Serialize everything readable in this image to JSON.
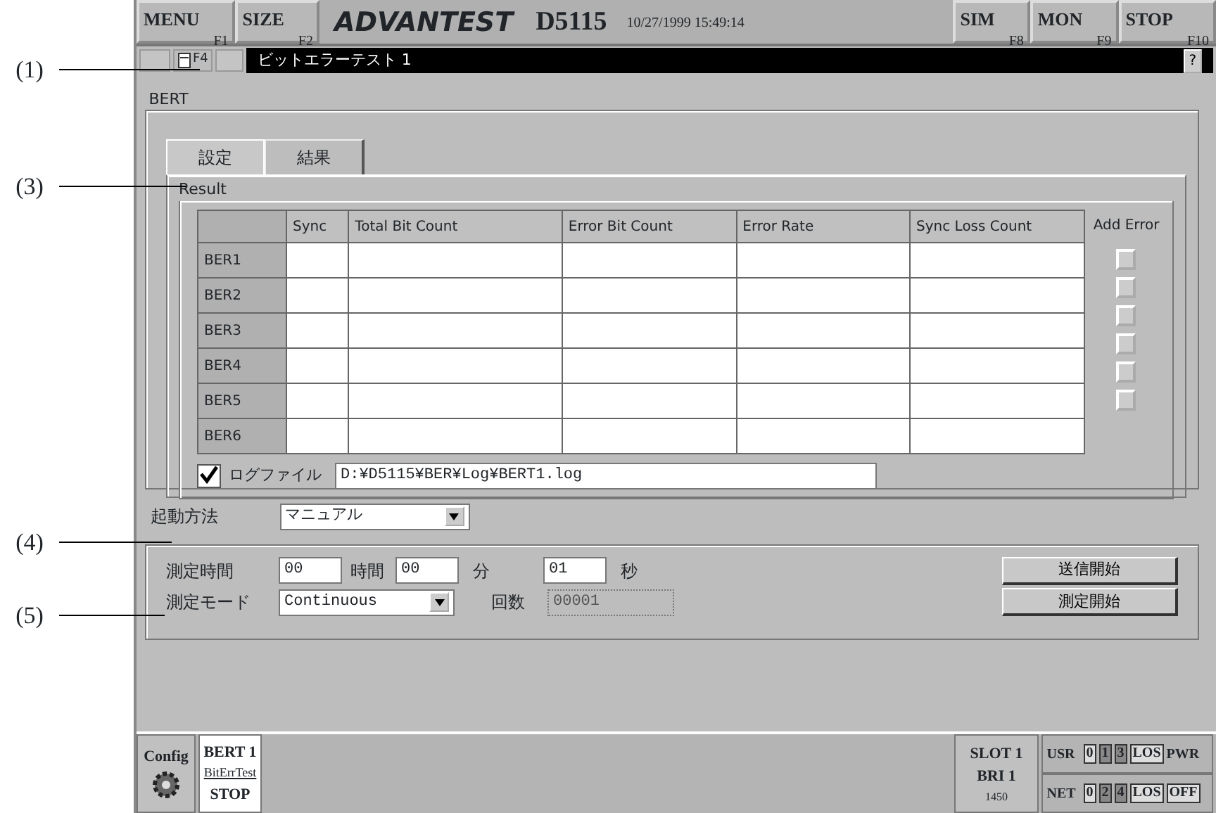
{
  "callouts": [
    {
      "label": "(1)"
    },
    {
      "label": "(3)"
    },
    {
      "label": "(4)"
    },
    {
      "label": "(5)"
    }
  ],
  "top_bar": {
    "left_keys": [
      {
        "label": "MENU",
        "fkey": "F1"
      },
      {
        "label": "SIZE",
        "fkey": "F2"
      }
    ],
    "brand": "ADVANTEST",
    "model": "D5115",
    "datetime": "10/27/1999 15:49:14",
    "right_keys": [
      {
        "label": "SIM",
        "fkey": "F8"
      },
      {
        "label": "MON",
        "fkey": "F9"
      },
      {
        "label": "STOP",
        "fkey": "F10"
      }
    ]
  },
  "toolbar": {
    "fkey": "F4"
  },
  "window": {
    "title": "ビットエラーテスト 1",
    "help": "?"
  },
  "group_label": "BERT",
  "tabs": [
    {
      "label": "設定",
      "selected": false
    },
    {
      "label": "結果",
      "selected": true
    }
  ],
  "result": {
    "label": "Result",
    "columns": [
      "Sync",
      "Total Bit Count",
      "Error Bit Count",
      "Error Rate",
      "Sync Loss Count"
    ],
    "add_error": "Add Error",
    "rows": [
      {
        "name": "BER1"
      },
      {
        "name": "BER2"
      },
      {
        "name": "BER3"
      },
      {
        "name": "BER4"
      },
      {
        "name": "BER5"
      },
      {
        "name": "BER6"
      }
    ]
  },
  "log": {
    "checked": true,
    "label": "ログファイル",
    "value": "D:¥D5115¥BER¥Log¥BERT1.log"
  },
  "start_method": {
    "label": "起動方法",
    "value": "マニュアル"
  },
  "measure": {
    "time_label": "測定時間",
    "hours": "00",
    "hours_unit": "時間",
    "minutes": "00",
    "minutes_unit": "分",
    "seconds": "01",
    "seconds_unit": "秒",
    "mode_label": "測定モード",
    "mode": "Continuous",
    "count_label": "回数",
    "count": "00001",
    "count_disabled": true,
    "buttons": [
      "送信開始",
      "測定開始"
    ]
  },
  "status_bar": {
    "config": "Config",
    "bert": "BERT 1",
    "test": "BitErrTest",
    "state": "STOP",
    "slot": "SLOT 1",
    "bri": "BRI 1",
    "code": "1450",
    "leds": [
      {
        "label": "USR",
        "boxes": [
          {
            "text": "0",
            "on": false
          },
          {
            "text": "1",
            "on": true
          },
          {
            "text": "3",
            "on": true
          },
          {
            "text": "LOS",
            "on": false
          }
        ],
        "tail": "PWR",
        "tail_boxed": false
      },
      {
        "label": "NET",
        "boxes": [
          {
            "text": "0",
            "on": false
          },
          {
            "text": "2",
            "on": true
          },
          {
            "text": "4",
            "on": true
          },
          {
            "text": "LOS",
            "on": false
          }
        ],
        "tail": "OFF",
        "tail_boxed": true
      }
    ]
  }
}
